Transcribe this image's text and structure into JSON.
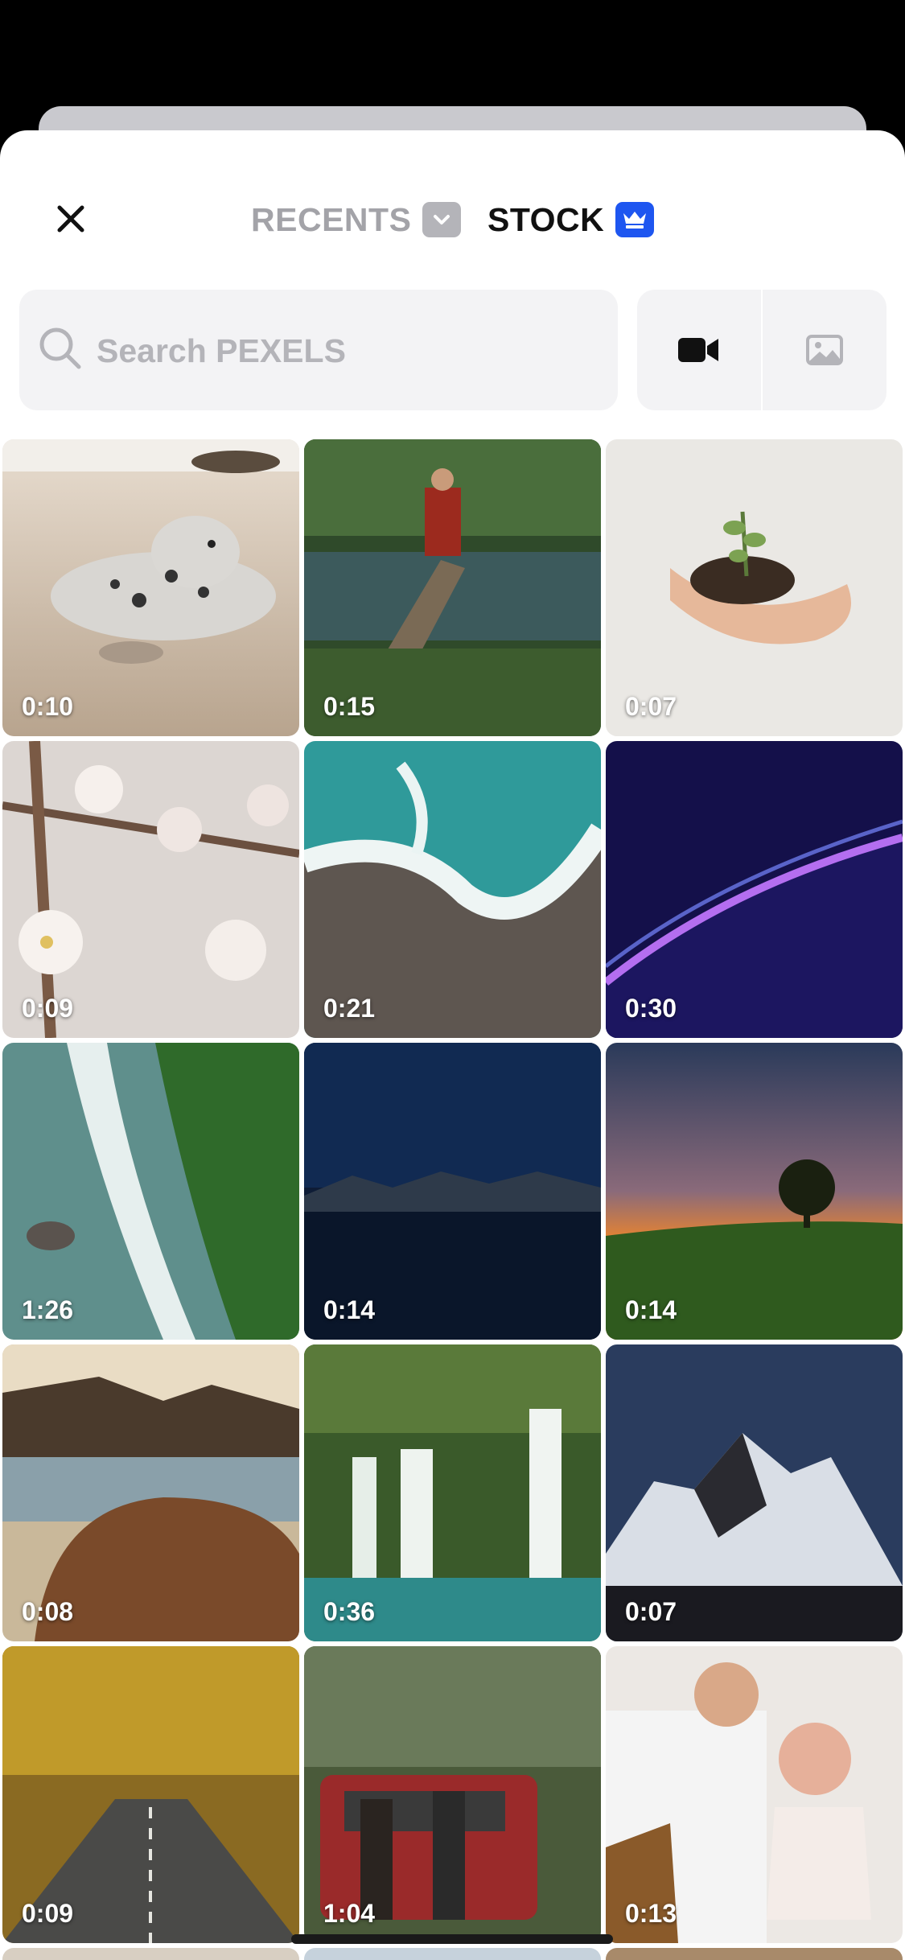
{
  "header": {
    "tabs": [
      {
        "label": "RECENTS",
        "active": false
      },
      {
        "label": "STOCK",
        "active": true
      }
    ]
  },
  "search": {
    "placeholder": "Search PEXELS",
    "value": ""
  },
  "media_filter": {
    "options": [
      {
        "icon": "video-camera-icon",
        "selected": true
      },
      {
        "icon": "image-icon",
        "selected": false
      }
    ]
  },
  "icons": {
    "close": "close-icon",
    "recents_badge": "chevron-down-icon",
    "stock_badge": "crown-icon",
    "search": "search-icon"
  },
  "colors": {
    "accent": "#1e56f0",
    "inactive_text": "#a3a3a8",
    "active_text": "#111111",
    "search_bg": "#f3f3f5"
  },
  "videos": [
    {
      "duration": "0:10",
      "subject": "seal"
    },
    {
      "duration": "0:15",
      "subject": "monk-on-tree"
    },
    {
      "duration": "0:07",
      "subject": "hands-seedling"
    },
    {
      "duration": "0:09",
      "subject": "cherry-blossom"
    },
    {
      "duration": "0:21",
      "subject": "aerial-waves"
    },
    {
      "duration": "0:30",
      "subject": "purple-particles"
    },
    {
      "duration": "1:26",
      "subject": "aerial-coast"
    },
    {
      "duration": "0:14",
      "subject": "night-lake"
    },
    {
      "duration": "0:14",
      "subject": "sunset-tree"
    },
    {
      "duration": "0:08",
      "subject": "rocky-shore"
    },
    {
      "duration": "0:36",
      "subject": "waterfall"
    },
    {
      "duration": "0:07",
      "subject": "snow-mountain-stars"
    },
    {
      "duration": "0:09",
      "subject": "autumn-road"
    },
    {
      "duration": "1:04",
      "subject": "couple-red-van"
    },
    {
      "duration": "0:13",
      "subject": "father-daughter-guitar"
    }
  ]
}
